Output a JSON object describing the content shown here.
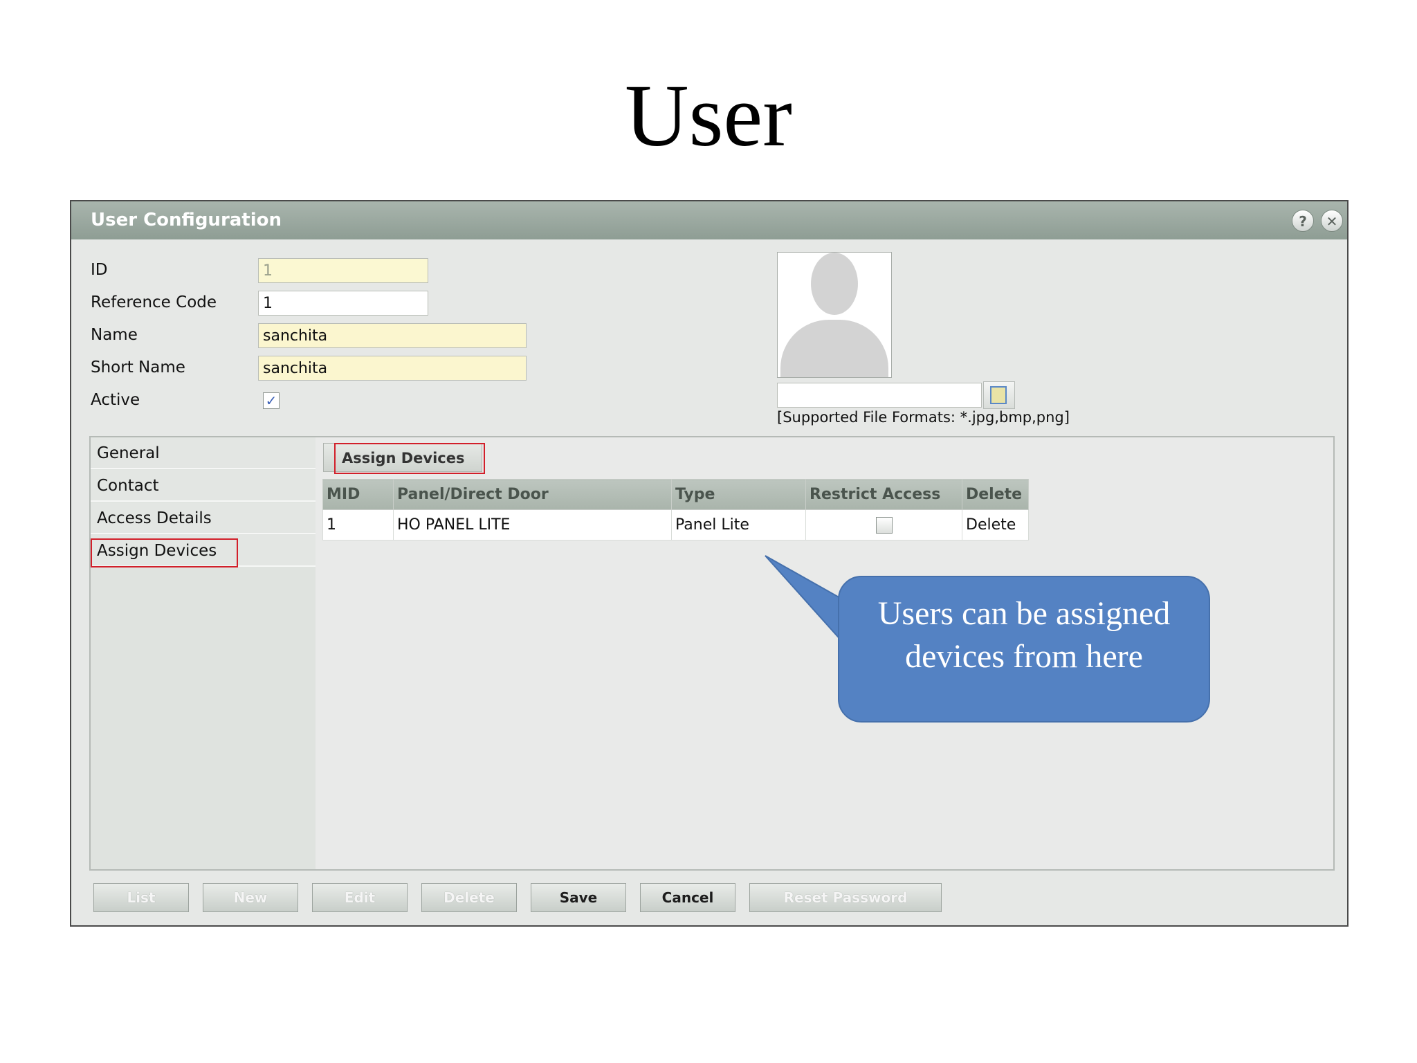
{
  "slide": {
    "title": "User"
  },
  "window": {
    "title": "User Configuration",
    "help_icon": "?",
    "close_icon": "✕"
  },
  "form": {
    "id_label": "ID",
    "id_value": "1",
    "ref_label": "Reference Code",
    "ref_value": "1",
    "name_label": "Name",
    "name_value": "sanchita",
    "short_label": "Short Name",
    "short_value": "sanchita",
    "active_label": "Active",
    "active_checked": true
  },
  "photo": {
    "formats": "[Supported File Formats: *.jpg,bmp,png]"
  },
  "sidebar": {
    "items": [
      {
        "label": "General"
      },
      {
        "label": "Contact"
      },
      {
        "label": "Access Details"
      },
      {
        "label": "Assign Devices"
      }
    ]
  },
  "assign": {
    "tab_label": "Assign Devices",
    "columns": [
      "MID",
      "Panel/Direct Door",
      "Type",
      "Restrict Access",
      "Delete"
    ],
    "rows": [
      {
        "mid": "1",
        "panel": "HO PANEL LITE",
        "type": "Panel Lite",
        "restrict": false,
        "delete": "Delete"
      }
    ]
  },
  "buttons": {
    "list": "List",
    "new": "New",
    "edit": "Edit",
    "delete": "Delete",
    "save": "Save",
    "cancel": "Cancel",
    "reset_password": "Reset Password"
  },
  "callout": {
    "line1": "Users  can be assigned",
    "line2": "devices from here"
  },
  "colors": {
    "callout": "#5482c3",
    "highlight": "#d21f2a",
    "titlebar": "#9aa89f"
  }
}
